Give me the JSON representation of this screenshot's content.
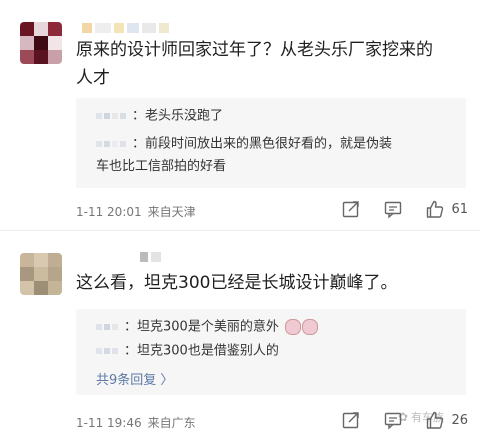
{
  "comments": [
    {
      "text_line1": "原来的设计师回家过年了？从老头乐厂家挖来的",
      "text_line2": "人才",
      "replies": [
        {
          "text": "：老头乐没跑了"
        },
        {
          "text_line1": "：前段时间放出来的黑色很好看的，就是伪装",
          "text_line2": "车也比工信部拍的好看"
        }
      ],
      "timestamp": "1-11 20:01",
      "source": "来自天津",
      "like_count": "61"
    },
    {
      "text": "这么看，坦克300已经是长城设计巅峰了。",
      "replies": [
        {
          "text": "：坦克300是个美丽的意外"
        },
        {
          "text": "：坦克300也是借鉴别人的"
        }
      ],
      "more_replies": "共9条回复 〉",
      "timestamp": "1-11 19:46",
      "source": "来自广东",
      "like_count": "26"
    }
  ],
  "watermark": "有车族",
  "icons": {
    "share": "share-icon",
    "comment": "comment-icon",
    "like": "thumbs-up-icon"
  },
  "colors": {
    "reply_bg": "#f6f6f6",
    "meta": "#777777",
    "link": "#5c7aa5"
  }
}
